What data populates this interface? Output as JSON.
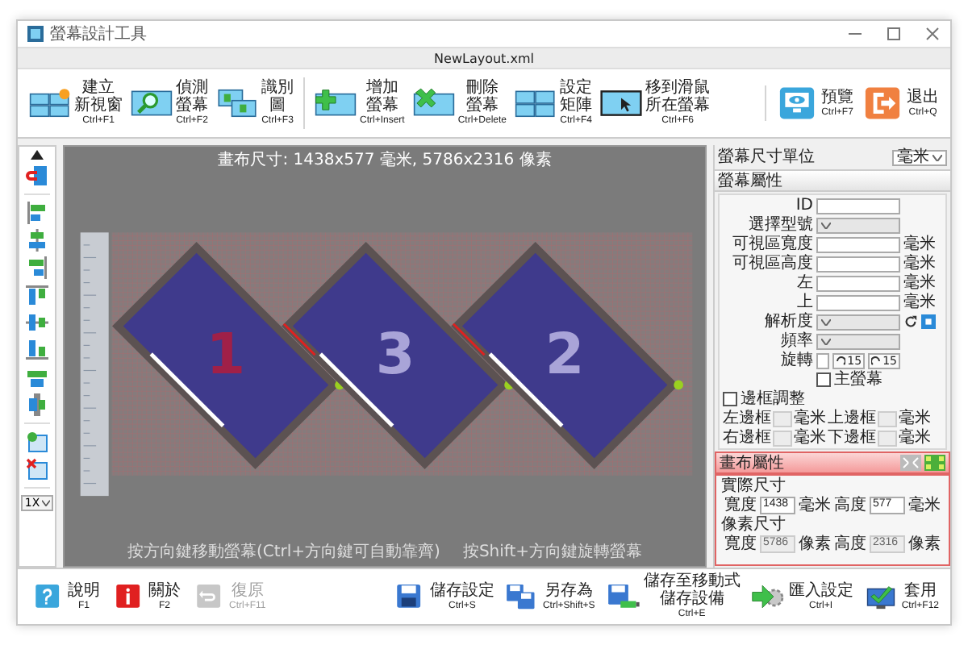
{
  "window": {
    "title": "螢幕設計工具",
    "file": "NewLayout.xml"
  },
  "toolbar": {
    "groups": [
      [
        {
          "kind": "new-layout",
          "lines": [
            "建立",
            "新視窗"
          ],
          "shortcut": "Ctrl+F1"
        },
        {
          "kind": "detect",
          "lines": [
            "偵測",
            "螢幕"
          ],
          "shortcut": "Ctrl+F2"
        },
        {
          "kind": "identify",
          "lines": [
            "識別",
            "圖"
          ],
          "shortcut": "Ctrl+F3"
        }
      ],
      [
        {
          "kind": "add",
          "lines": [
            "增加",
            "螢幕"
          ],
          "shortcut": "Ctrl+Insert"
        },
        {
          "kind": "delete",
          "lines": [
            "刪除",
            "螢幕"
          ],
          "shortcut": "Ctrl+Delete"
        },
        {
          "kind": "matrix",
          "lines": [
            "設定",
            "矩陣"
          ],
          "shortcut": "Ctrl+F4"
        },
        {
          "kind": "move-mouse",
          "lines": [
            "移到滑鼠",
            "所在螢幕"
          ],
          "shortcut": "Ctrl+F6"
        }
      ],
      [
        {
          "kind": "preview",
          "lines": [
            "預覽"
          ],
          "shortcut": "Ctrl+F7"
        },
        {
          "kind": "exit",
          "lines": [
            "退出"
          ],
          "shortcut": "Ctrl+Q"
        }
      ]
    ]
  },
  "side_strip": {
    "zoom": "1X"
  },
  "canvas": {
    "size_info": "畫布尺寸: 1438x577 毫米, 5786x2316 像素",
    "screens": [
      {
        "label": "1",
        "selected": true
      },
      {
        "label": "3",
        "selected": false
      },
      {
        "label": "2",
        "selected": false
      }
    ],
    "hints": [
      "按方向鍵移動螢幕(Ctrl+方向鍵可自動靠齊)",
      "按Shift+方向鍵旋轉螢幕"
    ]
  },
  "unit_setting": {
    "label": "螢幕尺寸單位",
    "value": "毫米"
  },
  "screen_properties": {
    "title": "螢幕屬性",
    "rows": [
      {
        "kind": "field",
        "label": "ID"
      },
      {
        "kind": "select",
        "label": "選擇型號"
      },
      {
        "kind": "field",
        "label": "可視區寬度",
        "unit": "毫米"
      },
      {
        "kind": "field",
        "label": "可視區高度",
        "unit": "毫米"
      },
      {
        "kind": "field",
        "label": "左",
        "unit": "毫米"
      },
      {
        "kind": "field",
        "label": "上",
        "unit": "毫米"
      },
      {
        "kind": "resolution",
        "label": "解析度"
      },
      {
        "kind": "select",
        "label": "頻率"
      },
      {
        "kind": "rotation",
        "label": "旋轉",
        "steps": [
          "15",
          "15"
        ]
      },
      {
        "kind": "checkbox",
        "label": "主螢幕",
        "checked": false
      }
    ],
    "border_adjust": {
      "label": "邊框調整",
      "checked": false
    },
    "borders": [
      {
        "label": "左邊框",
        "unit": "毫米"
      },
      {
        "label": "上邊框",
        "unit": "毫米"
      },
      {
        "label": "右邊框",
        "unit": "毫米"
      },
      {
        "label": "下邊框",
        "unit": "毫米"
      }
    ]
  },
  "canvas_properties": {
    "title": "畫布屬性",
    "groups": [
      {
        "title": "實際尺寸",
        "fields": [
          {
            "label": "寬度",
            "value": "1438",
            "unit": "毫米",
            "disabled": false
          },
          {
            "label": "高度",
            "value": "577",
            "unit": "毫米",
            "disabled": false
          }
        ]
      },
      {
        "title": "像素尺寸",
        "fields": [
          {
            "label": "寬度",
            "value": "5786",
            "unit": "像素",
            "disabled": true
          },
          {
            "label": "高度",
            "value": "2316",
            "unit": "像素",
            "disabled": true
          }
        ]
      }
    ]
  },
  "bottom_toolbar": {
    "groups": [
      [
        {
          "kind": "help",
          "lines": [
            "說明"
          ],
          "shortcut": "F1",
          "disabled": false
        },
        {
          "kind": "about",
          "lines": [
            "關於"
          ],
          "shortcut": "F2",
          "disabled": false
        },
        {
          "kind": "undo",
          "lines": [
            "復原"
          ],
          "shortcut": "Ctrl+F11",
          "disabled": true
        }
      ],
      [
        {
          "kind": "save",
          "lines": [
            "儲存設定"
          ],
          "shortcut": "Ctrl+S",
          "disabled": false
        },
        {
          "kind": "save-as",
          "lines": [
            "另存為"
          ],
          "shortcut": "Ctrl+Shift+S",
          "disabled": false
        },
        {
          "kind": "save-usb",
          "lines": [
            "儲存至移動式",
            "儲存設備"
          ],
          "shortcut": "Ctrl+E",
          "disabled": false
        },
        {
          "kind": "import",
          "lines": [
            "匯入設定"
          ],
          "shortcut": "Ctrl+I",
          "disabled": false
        },
        {
          "kind": "apply",
          "lines": [
            "套用"
          ],
          "shortcut": "Ctrl+F12",
          "disabled": false
        }
      ]
    ]
  }
}
